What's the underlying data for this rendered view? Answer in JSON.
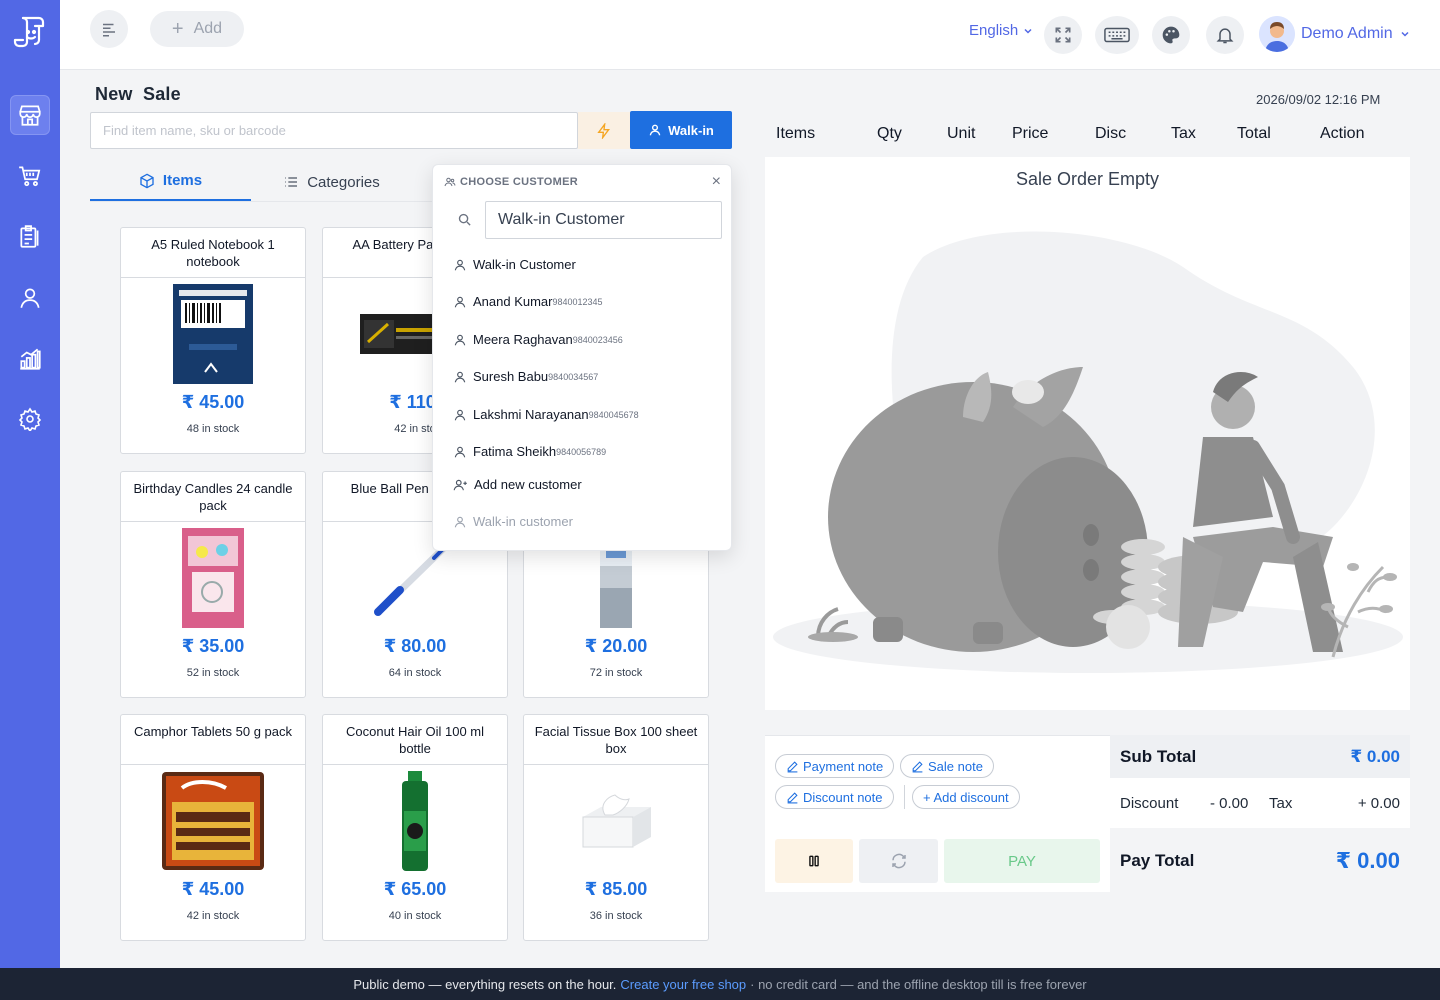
{
  "topbar": {
    "add_label": "Add",
    "language": "English",
    "user_name": "Demo Admin"
  },
  "sale": {
    "title": "New  Sale",
    "search_placeholder": "Find item name, sku or barcode",
    "walkin_label": "Walk-in",
    "datetime": "2026/09/02 12:16 PM"
  },
  "tabs": [
    {
      "label": "Items"
    },
    {
      "label": "Categories"
    }
  ],
  "products": [
    {
      "name": "A5 Ruled Notebook 1 notebook",
      "price": "₹ 45.00",
      "stock": "48 in stock"
    },
    {
      "name": "AA Battery Pack pack",
      "price": "₹ 110.",
      "stock": "42 in sto"
    },
    {
      "name": "Birthday Candles 24 candle pack",
      "price": "₹ 35.00",
      "stock": "52 in stock"
    },
    {
      "name": "Blue Ball Pen Pa pack",
      "price": "₹ 80.00",
      "stock": "64 in stock"
    },
    {
      "name": "",
      "price": "₹ 20.00",
      "stock": "72 in stock"
    },
    {
      "name": "Camphor Tablets 50 g pack",
      "price": "₹ 45.00",
      "stock": "42 in stock"
    },
    {
      "name": "Coconut Hair Oil 100 ml bottle",
      "price": "₹ 65.00",
      "stock": "40 in stock"
    },
    {
      "name": "Facial Tissue Box 100 sheet box",
      "price": "₹ 85.00",
      "stock": "36 in stock"
    }
  ],
  "customer_popup": {
    "header": "CHOOSE CUSTOMER",
    "close": "×",
    "search_value": "Walk-in Customer",
    "options": [
      {
        "name": "Walk-in Customer",
        "phone": ""
      },
      {
        "name": "Anand Kumar",
        "phone": "9840012345"
      },
      {
        "name": "Meera Raghavan",
        "phone": "9840023456"
      },
      {
        "name": "Suresh Babu",
        "phone": "9840034567"
      },
      {
        "name": "Lakshmi Narayanan",
        "phone": "9840045678"
      },
      {
        "name": "Fatima Sheikh",
        "phone": "9840056789"
      }
    ],
    "add_new": "Add new customer",
    "footer_option": "Walk-in customer"
  },
  "order": {
    "columns": [
      "Items",
      "Qty",
      "Unit",
      "Price",
      "Disc",
      "Tax",
      "Total",
      "Action"
    ],
    "empty_text": "Sale Order Empty"
  },
  "notes": {
    "payment_note": "Payment note",
    "sale_note": "Sale note",
    "discount_note": "Discount note",
    "add_discount": "+ Add discount"
  },
  "totals": {
    "sub_total_label": "Sub Total",
    "sub_total_value": "₹ 0.00",
    "discount_label": "Discount",
    "discount_value": "- 0.00",
    "tax_label": "Tax",
    "tax_value": "+ 0.00",
    "pay_total_label": "Pay Total",
    "pay_total_value": "₹ 0.00"
  },
  "actions": {
    "pay_label": "PAY"
  },
  "footer": {
    "text1": "Public demo — everything resets on the hour.",
    "link": "Create your free shop",
    "text2": "· no credit card — and the offline desktop till is free forever"
  },
  "colors": {
    "sidebar": "#5268e5",
    "accent": "#1e6fe0",
    "footer_bg": "#1c2434"
  }
}
